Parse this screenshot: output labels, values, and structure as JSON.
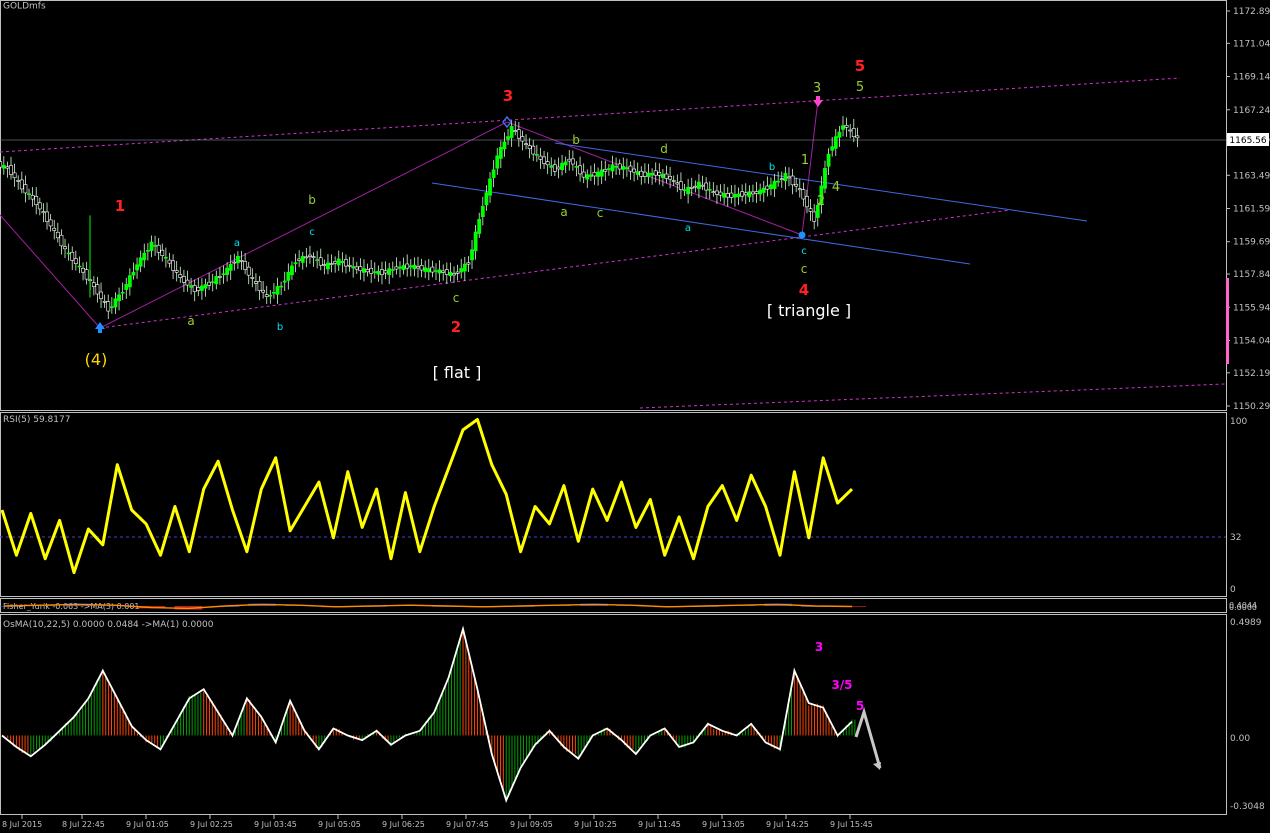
{
  "window": {
    "title": "GOLDmfs"
  },
  "colors": {
    "background": "#000000",
    "grid_border": "#c0c0c0",
    "candle_bull": "#00ff00",
    "candle_bear": "#ffffff",
    "rsi_line": "#ffff00",
    "wave_red": "#ff0000",
    "wave_yellow": "#ffff00",
    "wave_green": "#9acd32",
    "wave_cyan": "#00ffff",
    "channel_blue": "#4169e1",
    "channel_magenta": "#cc00cc",
    "osma_positive": "#00a000",
    "osma_negative": "#ff4500",
    "osma_signal": "#ffffff",
    "annot_magenta": "#ff00ff"
  },
  "price_panel": {
    "current_price": "1165.56",
    "wave_labels": {
      "w4_big": "(4)",
      "w1": "1",
      "w2": "2",
      "w3": "3",
      "w4": "4",
      "w5": "5",
      "w5b": "5",
      "a1": "a",
      "b1": "b",
      "a2": "a",
      "b2": "b",
      "c2": "c",
      "c3": "c",
      "b3": "b",
      "a3": "a",
      "c4": "c",
      "d1": "d",
      "a4": "a",
      "b4": "b",
      "c5": "c",
      "c6": "c",
      "s1": "1",
      "s2": "2",
      "s3": "3",
      "s4": "4"
    },
    "pattern_labels": {
      "flat": "[ flat ]",
      "triangle": "[ triangle ]"
    }
  },
  "rsi_panel": {
    "title": "RSI(5) 59.8177",
    "axis": [
      "100",
      "32",
      "0"
    ]
  },
  "fisher_panel": {
    "title": "Fisher_Yurik -0.063  ->MA(3) 0.001",
    "axis": [
      "0.4044",
      "0.0000"
    ]
  },
  "osma_panel": {
    "title": "OsMA(10,22,5) 0.0000 0.0484  ->MA(1) 0.0000",
    "axis": [
      "0.4989",
      "0.00",
      "-0.3048"
    ],
    "labels": {
      "l3": "3",
      "l35": "3/5",
      "l5": "5"
    }
  },
  "chart_data": [
    {
      "type": "line",
      "title": "GOLDmfs candlestick price",
      "y_axis_ticks": [
        "1172.89",
        "1171.04",
        "1169.14",
        "1167.24",
        "1165.56",
        "1163.49",
        "1161.59",
        "1159.69",
        "1157.84",
        "1155.94",
        "1154.04",
        "1152.19",
        "1150.29"
      ],
      "ylim": [
        1150.29,
        1172.89
      ],
      "x_axis_ticks": [
        "8 Jul 2015",
        "8 Jul 22:45",
        "9 Jul 01:05",
        "9 Jul 02:25",
        "9 Jul 03:45",
        "9 Jul 05:05",
        "9 Jul 06:25",
        "9 Jul 07:45",
        "9 Jul 09:05",
        "9 Jul 10:25",
        "9 Jul 11:45",
        "9 Jul 13:05",
        "9 Jul 14:25",
        "9 Jul 15:45"
      ],
      "series": [
        {
          "name": "close",
          "values": [
            1163.9,
            1162.8,
            1161.9,
            1160.6,
            1159.2,
            1158.2,
            1157.1,
            1155.8,
            1156.9,
            1158.4,
            1159.6,
            1158.7,
            1157.6,
            1156.9,
            1157.3,
            1157.9,
            1158.8,
            1157.5,
            1156.5,
            1157.2,
            1158.6,
            1158.9,
            1158.3,
            1158.6,
            1158.2,
            1158.0,
            1157.9,
            1158.2,
            1158.3,
            1158.1,
            1158.0,
            1157.8,
            1158.5,
            1161.8,
            1164.6,
            1166.2,
            1165.2,
            1164.4,
            1163.8,
            1164.4,
            1163.4,
            1163.6,
            1164.0,
            1163.9,
            1163.5,
            1163.6,
            1163.3,
            1162.6,
            1163.0,
            1162.5,
            1162.3,
            1162.4,
            1162.5,
            1162.9,
            1163.5,
            1162.6,
            1160.9,
            1164.8,
            1166.4,
            1165.6
          ]
        }
      ]
    },
    {
      "type": "line",
      "title": "RSI(5)",
      "ylim": [
        0,
        100
      ],
      "levels": [
        32
      ],
      "series": [
        {
          "name": "RSI(5)",
          "values": [
            46,
            20,
            44,
            18,
            40,
            10,
            35,
            26,
            72,
            46,
            38,
            20,
            48,
            22,
            58,
            74,
            46,
            22,
            58,
            76,
            34,
            48,
            62,
            30,
            68,
            36,
            58,
            18,
            56,
            22,
            48,
            70,
            92,
            98,
            72,
            55,
            22,
            48,
            38,
            60,
            28,
            58,
            40,
            62,
            36,
            52,
            20,
            42,
            18,
            48,
            60,
            40,
            66,
            48,
            20,
            68,
            30,
            76,
            50,
            58
          ]
        }
      ]
    },
    {
      "type": "line",
      "title": "Fisher_Yurik",
      "series": [
        {
          "name": "Fisher_Yurik",
          "values": [
            0.0,
            0.1,
            0.2,
            0.1,
            -0.2,
            -0.3,
            0.0,
            0.2,
            0.1,
            -0.1,
            0.0,
            0.1,
            0.0,
            -0.1,
            0.0,
            0.1,
            0.2,
            0.1,
            -0.1,
            0.0,
            0.1,
            0.2,
            0.0,
            -0.06
          ]
        }
      ]
    },
    {
      "type": "bar",
      "title": "OsMA(10,22,5)",
      "ylim": [
        -0.3048,
        0.4989
      ],
      "series": [
        {
          "name": "OsMA",
          "values": [
            0.0,
            -0.05,
            -0.09,
            -0.04,
            0.02,
            0.08,
            0.16,
            0.28,
            0.16,
            0.04,
            -0.02,
            -0.06,
            0.05,
            0.16,
            0.2,
            0.1,
            0.0,
            0.16,
            0.08,
            -0.03,
            0.15,
            0.02,
            -0.06,
            0.03,
            0.0,
            -0.02,
            0.02,
            -0.04,
            0.0,
            0.02,
            0.1,
            0.25,
            0.46,
            0.2,
            -0.08,
            -0.28,
            -0.14,
            -0.04,
            0.02,
            -0.05,
            -0.1,
            0.0,
            0.03,
            -0.02,
            -0.08,
            0.0,
            0.03,
            -0.05,
            -0.03,
            0.05,
            0.02,
            0.0,
            0.05,
            -0.03,
            -0.06,
            0.28,
            0.14,
            0.12,
            0.0,
            0.06
          ]
        }
      ]
    }
  ]
}
